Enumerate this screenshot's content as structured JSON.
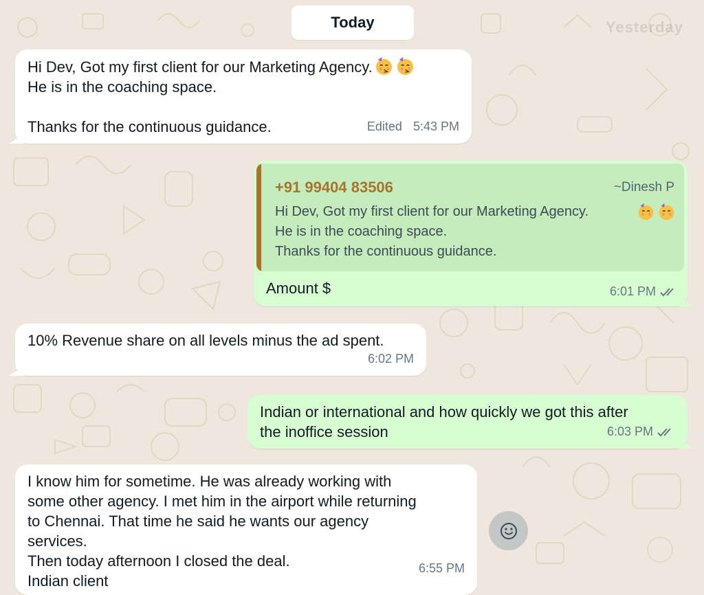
{
  "date_divider": {
    "label": "Today",
    "ghost_label": "Yesterday"
  },
  "messages": [
    {
      "direction": "incoming",
      "lines": [
        "Hi Dev, Got my first client for our Marketing Agency.",
        "He is in the coaching space.",
        "",
        "Thanks for the continuous guidance."
      ],
      "edited": "Edited",
      "time": "5:43 PM"
    },
    {
      "direction": "outgoing",
      "quote": {
        "phone": "+91 99404 83506",
        "author": "~Dinesh P",
        "text": "Hi Dev, Got my first client for our Marketing Agency.\nHe is in the coaching space.\nThanks for the continuous guidance."
      },
      "text": "Amount $",
      "time": "6:01 PM",
      "status": "read"
    },
    {
      "direction": "incoming",
      "text": "10% Revenue share on all levels minus the ad spent.",
      "time": "6:02 PM"
    },
    {
      "direction": "outgoing",
      "text": "Indian or international and how quickly we got this after\nthe inoffice session",
      "time": "6:03 PM",
      "status": "read"
    },
    {
      "direction": "incoming",
      "text": "I know him for sometime. He was already working with\nsome other agency. I met him in the airport while returning\nto Chennai. That time he said he wants our agency\nservices.\nThen today afternoon I closed the deal.\nIndian client",
      "time": "6:55 PM"
    }
  ],
  "icons": {
    "emoji": "partying-face-emoji",
    "read_status": "double-check-icon",
    "emoji_button": "smiley-icon"
  },
  "colors": {
    "wallpaper": "#efe7dd",
    "incoming_bubble": "#ffffff",
    "outgoing_bubble": "#d9fdd3",
    "quote_bg": "#c6ecbd",
    "quote_accent": "#a8742b",
    "meta_text": "#667781"
  }
}
